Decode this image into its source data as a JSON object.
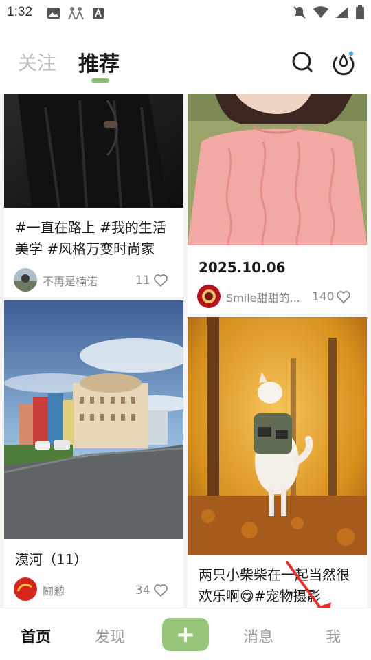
{
  "status_bar": {
    "time": "1:32",
    "icons_left": [
      "image-icon",
      "notification-figure-icon",
      "text-a-icon"
    ],
    "icons_right": [
      "bell-off-icon",
      "wifi-icon",
      "signal-icon",
      "battery-icon"
    ]
  },
  "header": {
    "tab_follow": "关注",
    "tab_recommend": "推荐",
    "accent_color": "#8fc06a"
  },
  "feed": {
    "left_column": [
      {
        "title": "#一直在路上 #我的生活美学 #风格万变时尚家",
        "author": "不再是楠诺",
        "likes": "11"
      },
      {
        "title": "漠河（11）",
        "author": "闘懃",
        "likes": "34"
      }
    ],
    "right_column": [
      {
        "title": "2025.10.06",
        "author": "Smile甜甜的...",
        "likes": "140"
      },
      {
        "title": "两只小柴柴在一起当然很欢乐啊😋#宠物摄影",
        "author": "",
        "likes": ""
      }
    ]
  },
  "bottom_nav": {
    "home": "首页",
    "discover": "发现",
    "post": "+",
    "messages": "消息",
    "me": "我"
  }
}
